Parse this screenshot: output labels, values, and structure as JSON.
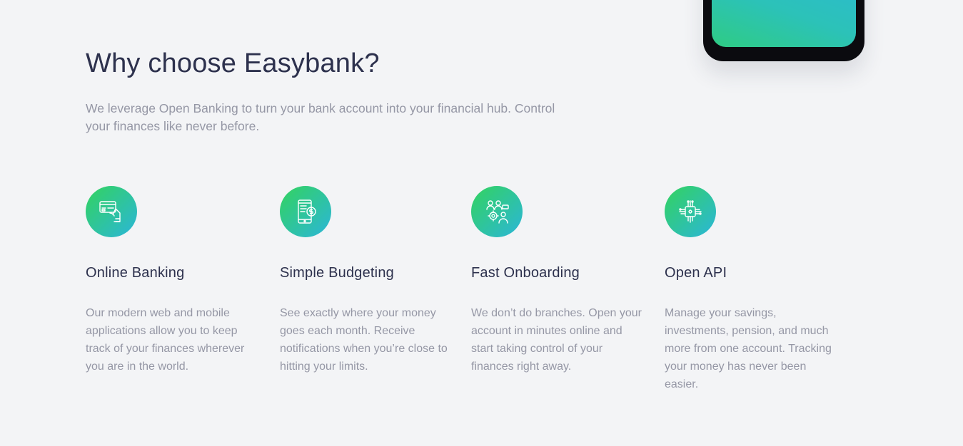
{
  "section": {
    "title": "Why choose Easybank?",
    "intro": "We leverage Open Banking to turn your bank account into your financial hub. Control your finances like never before."
  },
  "colors": {
    "heading": "#2d314d",
    "text": "#9597a5",
    "background": "#f3f4f6",
    "gradient_start": "#33d35e",
    "gradient_end": "#2bb6d9"
  },
  "features": [
    {
      "icon": "online-banking-icon",
      "title": "Online Banking",
      "description": "Our modern web and mobile applications allow you to keep track of your finances wherever you are in the world."
    },
    {
      "icon": "budgeting-icon",
      "title": "Simple Budgeting",
      "description": "See exactly where your money goes each month. Receive notifications when you’re close to hitting your limits."
    },
    {
      "icon": "onboarding-icon",
      "title": "Fast Onboarding",
      "description": "We don’t do branches. Open your account in minutes online and start taking control of your finances right away."
    },
    {
      "icon": "api-icon",
      "title": "Open API",
      "description": "Manage your savings, investments, pension, and much more from one account. Tracking your money has never been easier."
    }
  ]
}
